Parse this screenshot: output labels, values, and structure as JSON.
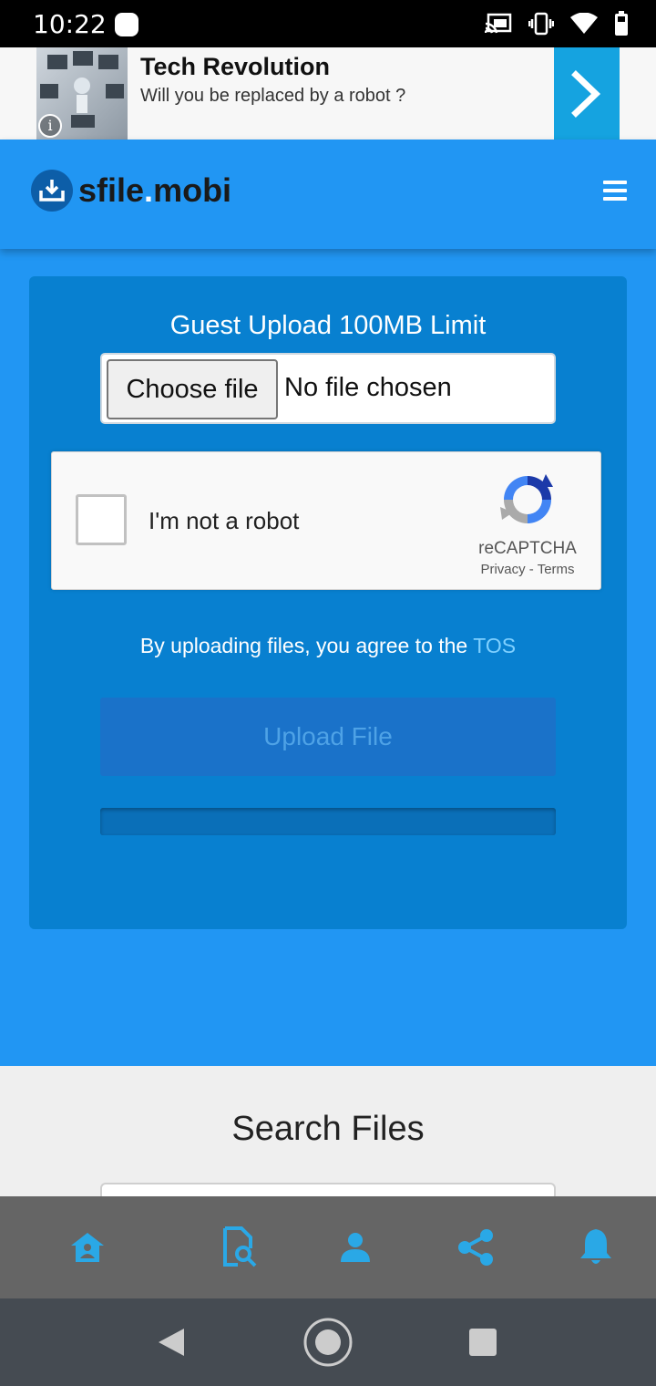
{
  "status_bar": {
    "time": "10:22"
  },
  "ad": {
    "title": "Tech Revolution",
    "subtitle": "Will you be replaced by a robot ?",
    "info_glyph": "i"
  },
  "header": {
    "logo_part1": "sfile",
    "logo_dot": ".",
    "logo_part2": "mobi"
  },
  "upload": {
    "title": "Guest Upload 100MB Limit",
    "choose_button": "Choose file",
    "file_status": "No file chosen",
    "captcha_label": "I'm not a robot",
    "captcha_brand": "reCAPTCHA",
    "captcha_privacy": "Privacy",
    "captcha_sep": " - ",
    "captcha_terms": "Terms",
    "tos_text": "By uploading files, you agree to the ",
    "tos_link": "TOS",
    "upload_button": "Upload File",
    "progress": 0
  },
  "search": {
    "title": "Search Files"
  },
  "bottom_nav": {
    "items": [
      {
        "icon": "home-icon"
      },
      {
        "icon": "file-search-icon"
      },
      {
        "icon": "user-icon"
      },
      {
        "icon": "share-icon"
      },
      {
        "icon": "bell-icon"
      }
    ]
  },
  "colors": {
    "primary": "#2196f3",
    "card": "#0880d0",
    "nav_icon": "#2aa8e6",
    "ad_arrow": "#15a3e0"
  }
}
